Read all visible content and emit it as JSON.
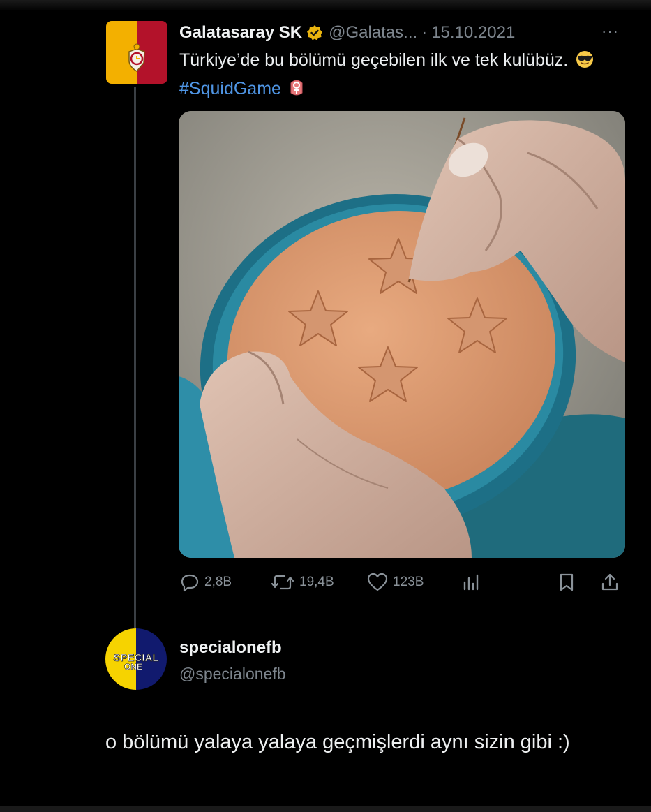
{
  "tweet": {
    "author_name": "Galatasaray SK",
    "author_handle": "@Galatas...",
    "separator": "·",
    "date": "15.10.2021",
    "text_main": "Türkiye’de bu bölümü geçebilen ilk ve tek kulübüz.",
    "hashtag": "#SquidGame",
    "stats": {
      "replies": "2,8B",
      "retweets": "19,4B",
      "likes": "123B"
    }
  },
  "reply": {
    "author_name": "specialonefb",
    "author_handle": "@specialonefb",
    "text": "o bölümü yalaya yalaya geçmişlerdi aynı sizin gibi :)",
    "avatar_text_top": "SPECIAL",
    "avatar_text_bottom": "ONE"
  },
  "colors": {
    "background": "#000000",
    "hashtag": "#4f95e4",
    "muted": "#7d858d",
    "gs_yellow": "#f3b000",
    "gs_red": "#b3122a",
    "fb_yellow": "#f6d300",
    "fb_navy": "#111a6e"
  },
  "icons": [
    "verified-badge-icon",
    "more-icon",
    "sunglasses-emoji-icon",
    "squid-game-emoji-icon",
    "reply-icon",
    "retweet-icon",
    "like-icon",
    "views-icon",
    "bookmark-icon",
    "share-icon"
  ]
}
